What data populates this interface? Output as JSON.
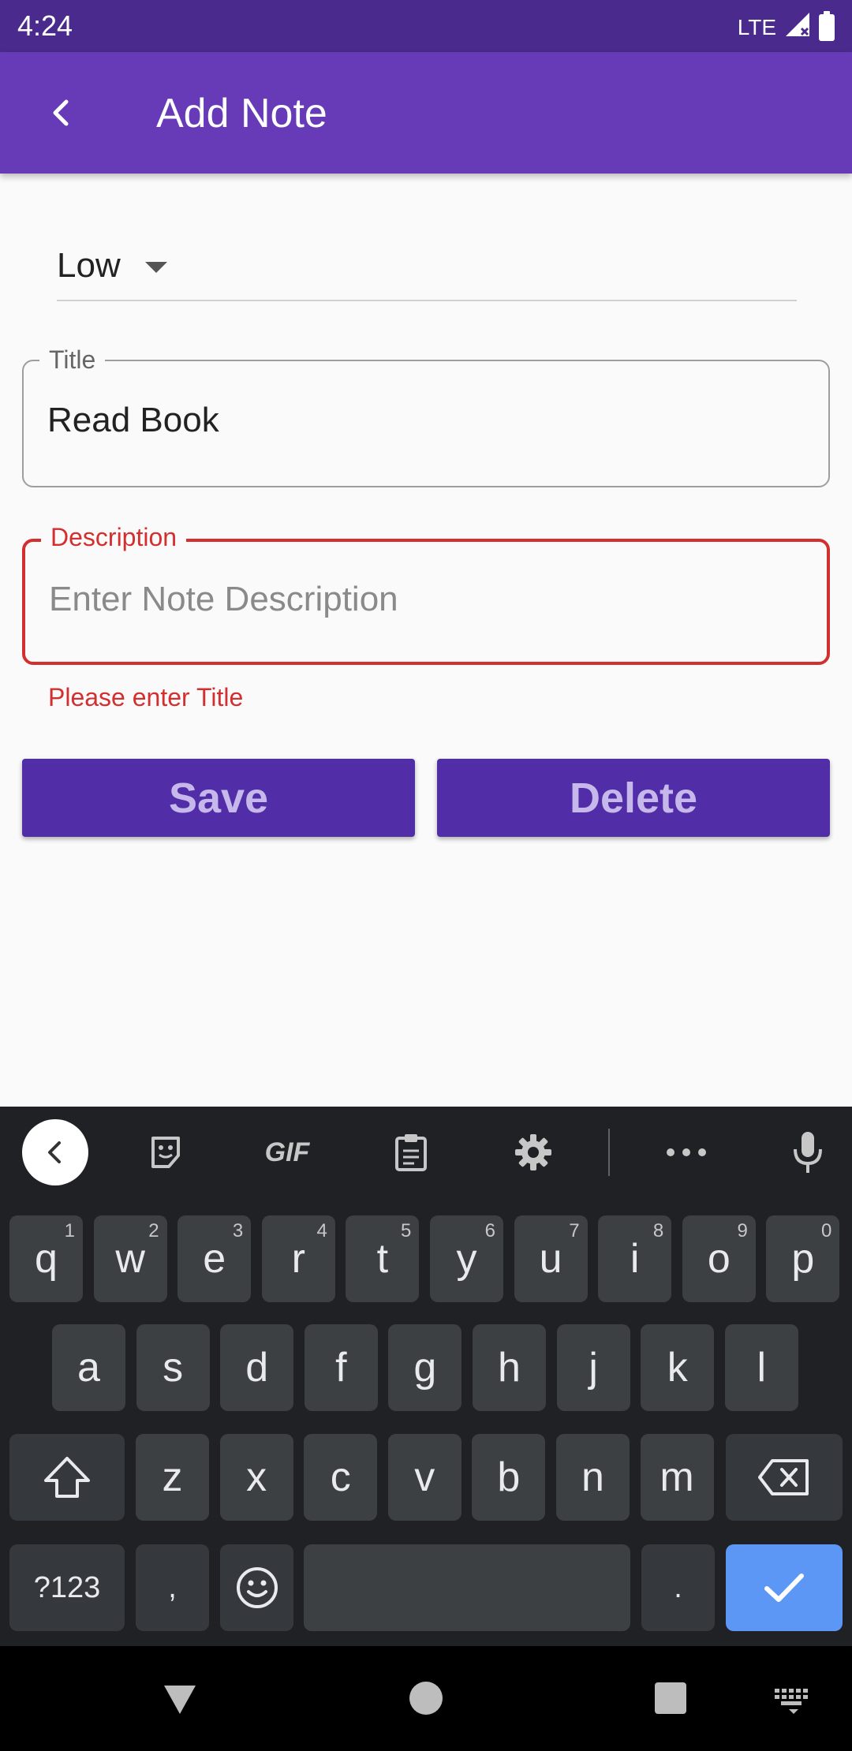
{
  "status_bar": {
    "time": "4:24",
    "network": "LTE"
  },
  "app_bar": {
    "title": "Add Note"
  },
  "form": {
    "priority": {
      "value": "Low"
    },
    "title_field": {
      "label": "Title",
      "value": "Read Book"
    },
    "description_field": {
      "label": "Description",
      "value": "",
      "placeholder": "Enter Note Description"
    },
    "error_text": "Please enter Title"
  },
  "buttons": {
    "save_label": "Save",
    "delete_label": "Delete"
  },
  "keyboard": {
    "toolbar": {
      "gif_label": "GIF"
    },
    "rows": [
      [
        {
          "label": "q",
          "hint": "1"
        },
        {
          "label": "w",
          "hint": "2"
        },
        {
          "label": "e",
          "hint": "3"
        },
        {
          "label": "r",
          "hint": "4"
        },
        {
          "label": "t",
          "hint": "5"
        },
        {
          "label": "y",
          "hint": "6"
        },
        {
          "label": "u",
          "hint": "7"
        },
        {
          "label": "i",
          "hint": "8"
        },
        {
          "label": "o",
          "hint": "9"
        },
        {
          "label": "p",
          "hint": "0"
        }
      ],
      [
        {
          "label": "a"
        },
        {
          "label": "s"
        },
        {
          "label": "d"
        },
        {
          "label": "f"
        },
        {
          "label": "g"
        },
        {
          "label": "h"
        },
        {
          "label": "j"
        },
        {
          "label": "k"
        },
        {
          "label": "l"
        }
      ],
      [
        {
          "label": "z"
        },
        {
          "label": "x"
        },
        {
          "label": "c"
        },
        {
          "label": "v"
        },
        {
          "label": "b"
        },
        {
          "label": "n"
        },
        {
          "label": "m"
        }
      ]
    ],
    "symbols_label": "?123",
    "comma_label": ",",
    "period_label": "."
  },
  "colors": {
    "status_bar": "#4a2a8c",
    "app_bar": "#673ab7",
    "button": "#512da8",
    "error": "#d32f2f",
    "enter_key": "#5d97f5"
  },
  "icons": [
    "back-arrow-icon",
    "dropdown-caret-icon",
    "sticker-icon",
    "clipboard-icon",
    "gear-icon",
    "more-icon",
    "microphone-icon",
    "shift-icon",
    "backspace-icon",
    "emoji-icon",
    "check-icon",
    "nav-back-icon",
    "nav-home-icon",
    "nav-recents-icon",
    "keyboard-switch-icon"
  ]
}
